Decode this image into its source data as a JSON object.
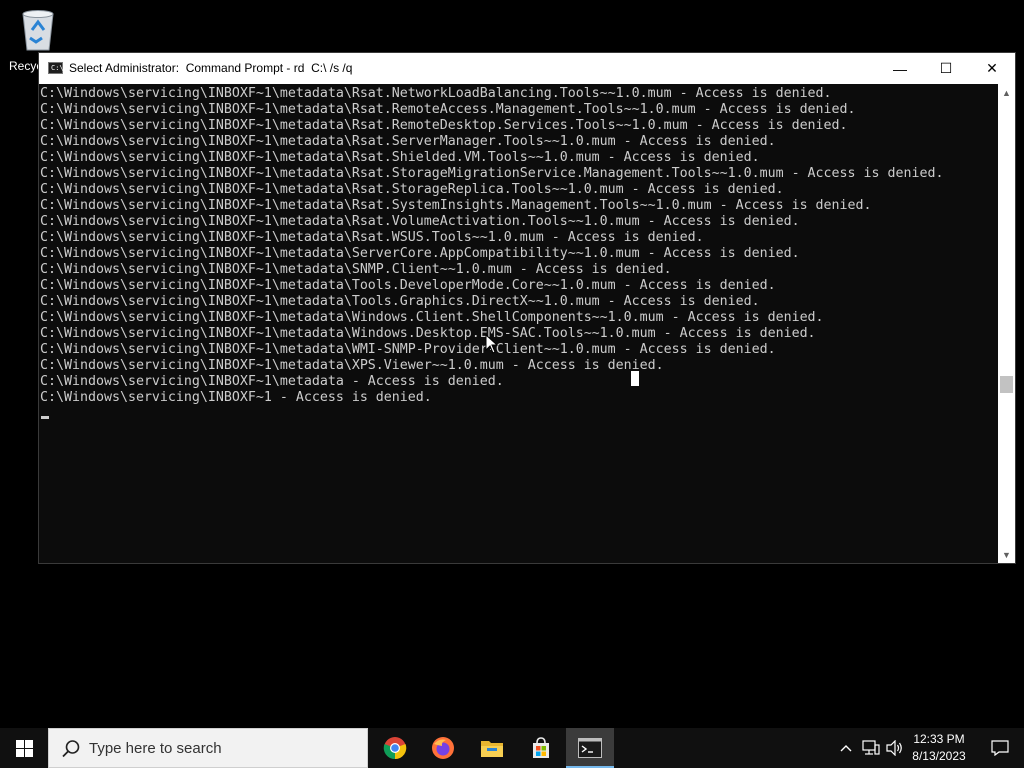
{
  "desktop": {
    "recycle_bin_label": "Recyc"
  },
  "window": {
    "title": "Select Administrator:  Command Prompt - rd  C:\\ /s /q",
    "icon_glyph": "C:\\_",
    "minimize_glyph": "—",
    "maximize_glyph": "☐",
    "close_glyph": "✕"
  },
  "console": {
    "lines": [
      "C:\\Windows\\servicing\\INBOXF~1\\metadata\\Rsat.NetworkLoadBalancing.Tools~~1.0.mum - Access is denied.",
      "C:\\Windows\\servicing\\INBOXF~1\\metadata\\Rsat.RemoteAccess.Management.Tools~~1.0.mum - Access is denied.",
      "C:\\Windows\\servicing\\INBOXF~1\\metadata\\Rsat.RemoteDesktop.Services.Tools~~1.0.mum - Access is denied.",
      "C:\\Windows\\servicing\\INBOXF~1\\metadata\\Rsat.ServerManager.Tools~~1.0.mum - Access is denied.",
      "C:\\Windows\\servicing\\INBOXF~1\\metadata\\Rsat.Shielded.VM.Tools~~1.0.mum - Access is denied.",
      "C:\\Windows\\servicing\\INBOXF~1\\metadata\\Rsat.StorageMigrationService.Management.Tools~~1.0.mum - Access is denied.",
      "C:\\Windows\\servicing\\INBOXF~1\\metadata\\Rsat.StorageReplica.Tools~~1.0.mum - Access is denied.",
      "C:\\Windows\\servicing\\INBOXF~1\\metadata\\Rsat.SystemInsights.Management.Tools~~1.0.mum - Access is denied.",
      "C:\\Windows\\servicing\\INBOXF~1\\metadata\\Rsat.VolumeActivation.Tools~~1.0.mum - Access is denied.",
      "C:\\Windows\\servicing\\INBOXF~1\\metadata\\Rsat.WSUS.Tools~~1.0.mum - Access is denied.",
      "C:\\Windows\\servicing\\INBOXF~1\\metadata\\ServerCore.AppCompatibility~~1.0.mum - Access is denied.",
      "C:\\Windows\\servicing\\INBOXF~1\\metadata\\SNMP.Client~~1.0.mum - Access is denied.",
      "C:\\Windows\\servicing\\INBOXF~1\\metadata\\Tools.DeveloperMode.Core~~1.0.mum - Access is denied.",
      "C:\\Windows\\servicing\\INBOXF~1\\metadata\\Tools.Graphics.DirectX~~1.0.mum - Access is denied.",
      "C:\\Windows\\servicing\\INBOXF~1\\metadata\\Windows.Client.ShellComponents~~1.0.mum - Access is denied.",
      "C:\\Windows\\servicing\\INBOXF~1\\metadata\\Windows.Desktop.EMS-SAC.Tools~~1.0.mum - Access is denied.",
      "C:\\Windows\\servicing\\INBOXF~1\\metadata\\WMI-SNMP-Provider-Client~~1.0.mum - Access is denied.",
      "C:\\Windows\\servicing\\INBOXF~1\\metadata\\XPS.Viewer~~1.0.mum - Access is denied.",
      "C:\\Windows\\servicing\\INBOXF~1\\metadata - Access is denied.",
      "C:\\Windows\\servicing\\INBOXF~1 - Access is denied."
    ]
  },
  "taskbar": {
    "search_placeholder": "Type here to search",
    "apps": [
      "chrome-icon",
      "firefox-icon",
      "file-explorer-icon",
      "store-icon",
      "command-prompt-icon"
    ],
    "clock_time": "12:33 PM",
    "clock_date": "8/13/2023"
  },
  "colors": {
    "console_bg": "#0c0c0c",
    "console_text": "#cccccc",
    "taskbar_bg": "#101010",
    "active_indicator": "#76b9ed"
  }
}
